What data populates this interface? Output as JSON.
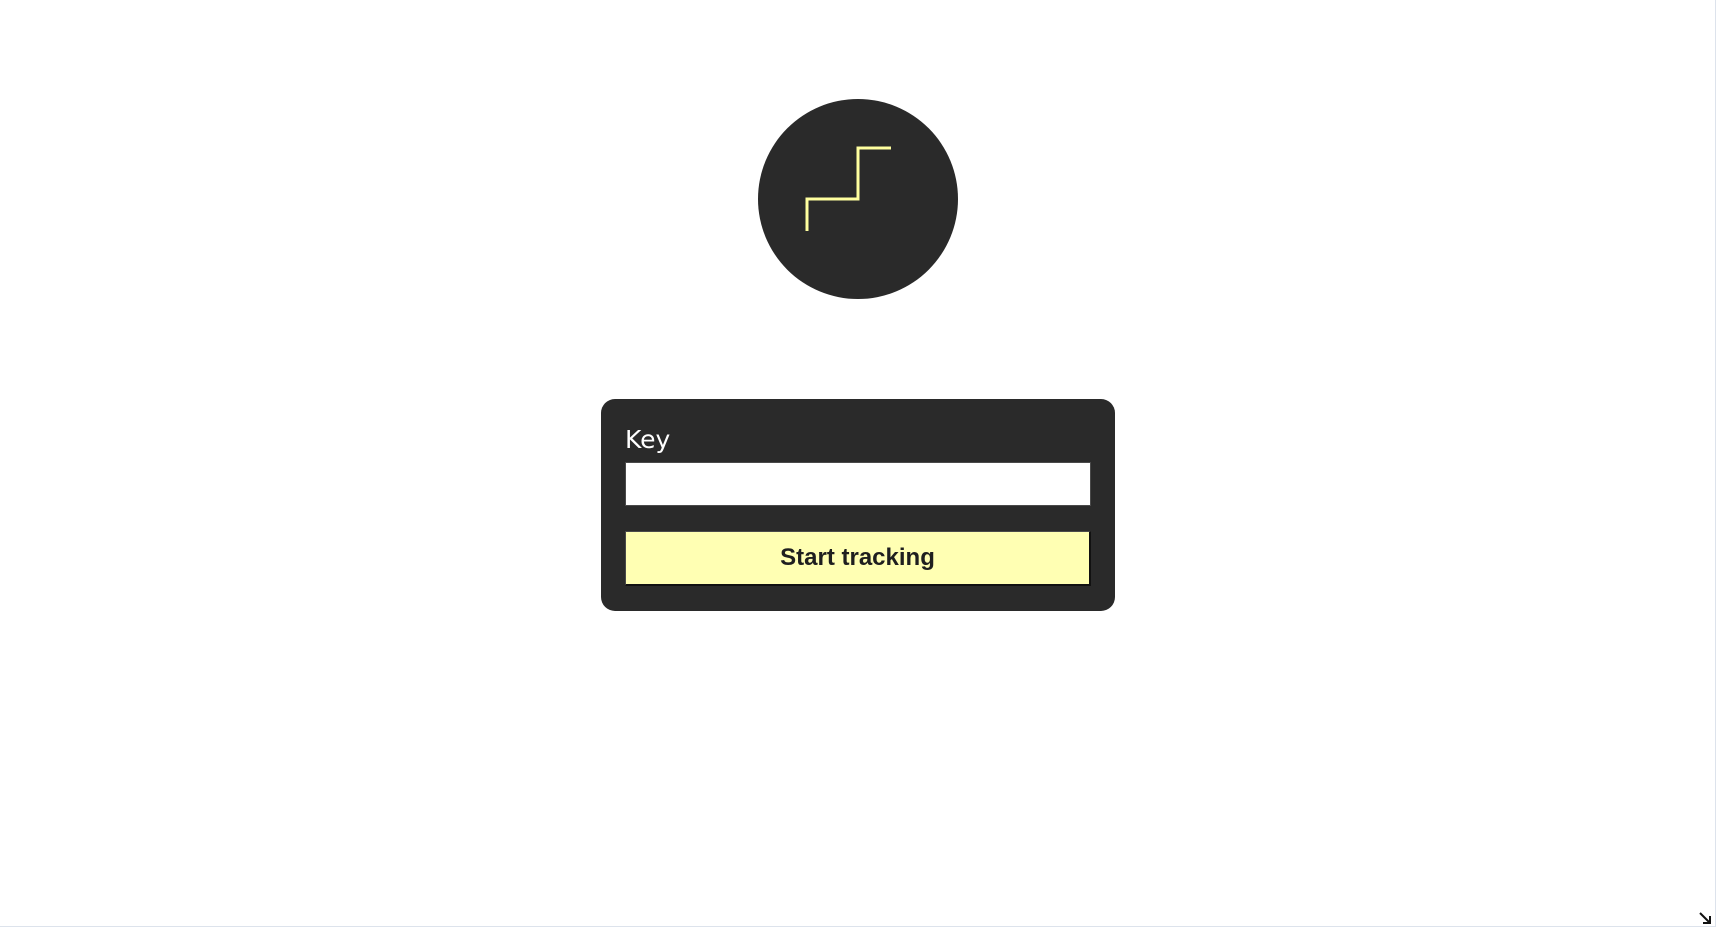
{
  "logo": {
    "icon": "step-chart-icon",
    "background_color": "#2a2a2a",
    "line_color": "#ffff9f"
  },
  "form": {
    "key_label": "Key",
    "key_value": "",
    "key_placeholder": "",
    "start_button_label": "Start tracking",
    "button_color": "#ffffb3"
  },
  "window": {
    "resize_icon": "resize-corner-icon"
  }
}
